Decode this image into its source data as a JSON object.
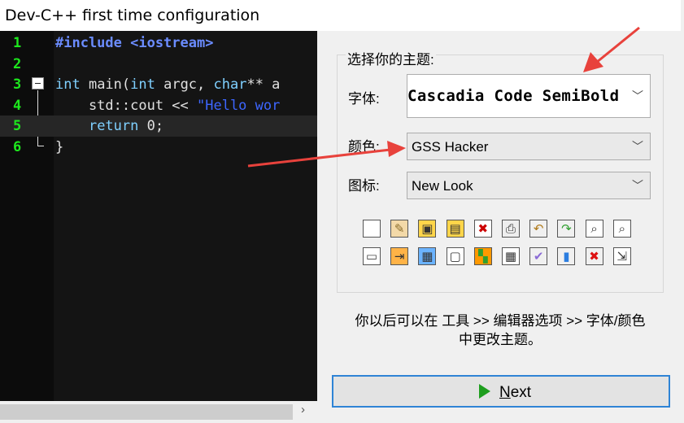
{
  "window": {
    "title": "Dev-C++ first time configuration"
  },
  "editor": {
    "lines": [
      {
        "num": "1",
        "tokens": [
          {
            "t": "#include <iostream>",
            "c": "inc"
          }
        ]
      },
      {
        "num": "2",
        "tokens": []
      },
      {
        "num": "3",
        "tokens": [
          {
            "t": "int",
            "c": "kw"
          },
          {
            "t": " main(",
            "c": ""
          },
          {
            "t": "int",
            "c": "kw"
          },
          {
            "t": " argc, ",
            "c": ""
          },
          {
            "t": "char",
            "c": "kw"
          },
          {
            "t": "** a",
            "c": ""
          }
        ]
      },
      {
        "num": "4",
        "tokens": [
          {
            "t": "    std::cout << ",
            "c": ""
          },
          {
            "t": "\"Hello wor",
            "c": "str"
          }
        ]
      },
      {
        "num": "5",
        "tokens": [
          {
            "t": "    ",
            "c": ""
          },
          {
            "t": "return",
            "c": "kw"
          },
          {
            "t": " 0;",
            "c": ""
          }
        ]
      },
      {
        "num": "6",
        "tokens": [
          {
            "t": "}",
            "c": ""
          }
        ]
      }
    ],
    "highlighted_line": "5"
  },
  "theme": {
    "group_label": "选择你的主题:",
    "font_label": "字体:",
    "font_value": "Cascadia Code SemiBold",
    "color_label": "颜色:",
    "color_value": "GSS Hacker",
    "icon_label": "图标:",
    "icon_value": "New Look",
    "preview_icons": [
      "new-file-icon",
      "open-file-icon",
      "save-icon",
      "save-all-icon",
      "close-file-icon",
      "print-icon",
      "undo-icon",
      "redo-icon",
      "find-icon",
      "replace-icon",
      "project-icon",
      "insert-icon",
      "class-browser-icon",
      "window-icon",
      "layout-icon",
      "grid-icon",
      "check-icon",
      "chart-icon",
      "delete-icon",
      "goto-icon"
    ]
  },
  "note": {
    "line1": "你以后可以在 工具 >> 编辑器选项 >> 字体/颜色",
    "line2": "中更改主题。"
  },
  "next_button": {
    "mnemonic": "N",
    "rest": "ext"
  },
  "colors": {
    "accent": "#2f84d6",
    "annotation_arrow": "#e8423c",
    "editor_bg": "#141414",
    "line_number": "#1de91d"
  }
}
